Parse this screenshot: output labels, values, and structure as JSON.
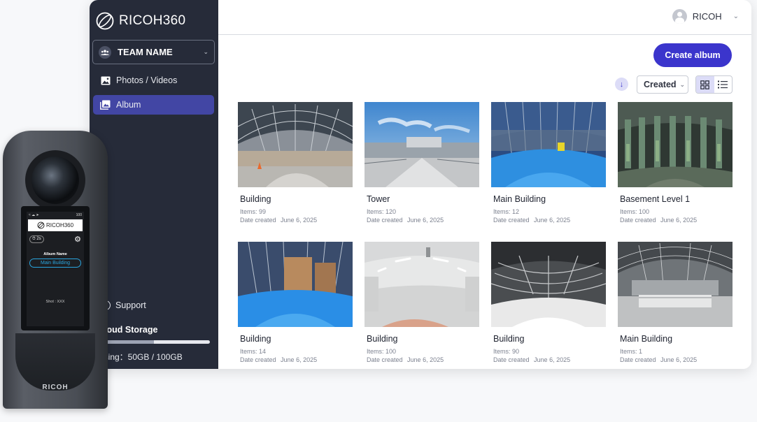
{
  "sidebar": {
    "logo_text": "RICOH360",
    "team_name": "TEAM NAME",
    "nav": [
      {
        "label": "Photos / Videos",
        "icon": "image-icon"
      },
      {
        "label": "Album",
        "icon": "album-icon",
        "active": true
      }
    ],
    "support_label": "Support",
    "storage": {
      "title": "Cloud Storage",
      "usage_text": "Using：50GB / 100GB",
      "used_fraction": 0.5
    }
  },
  "header": {
    "user_name": "RICOH"
  },
  "toolbar": {
    "create_label": "Create album",
    "sort_value": "Created"
  },
  "albums": [
    {
      "title": "Building",
      "items_label": "Items:",
      "items": "99",
      "date_label": "Date created",
      "date": "June 6, 2025"
    },
    {
      "title": "Tower",
      "items_label": "Items:",
      "items": "120",
      "date_label": "Date created",
      "date": "June 6, 2025"
    },
    {
      "title": "Main Building",
      "items_label": "Items:",
      "items": "12",
      "date_label": "Date created",
      "date": "June 6, 2025"
    },
    {
      "title": "Basement Level 1",
      "items_label": "Items:",
      "items": "100",
      "date_label": "Date created",
      "date": "June 6, 2025"
    },
    {
      "title": "Building",
      "items_label": "Items:",
      "items": "14",
      "date_label": "Date created",
      "date": "June 6, 2025"
    },
    {
      "title": "Building",
      "items_label": "Items:",
      "items": "100",
      "date_label": "Date created",
      "date": "June 6, 2025"
    },
    {
      "title": "Building",
      "items_label": "Items:",
      "items": "90",
      "date_label": "Date created",
      "date": "June 6, 2025"
    },
    {
      "title": "Main Building",
      "items_label": "Items:",
      "items": "1",
      "date_label": "Date created",
      "date": "June 6, 2025"
    }
  ],
  "camera": {
    "battery": "100",
    "logo_text": "RICOH360",
    "timer": "2s",
    "album_label": "Album Name",
    "album_name": "Main Building",
    "shot": "Shot : XXX",
    "brand": "RICOH"
  },
  "colors": {
    "sidebar_bg": "#262b39",
    "accent": "#3b35cc",
    "nav_active": "#4246a4"
  }
}
